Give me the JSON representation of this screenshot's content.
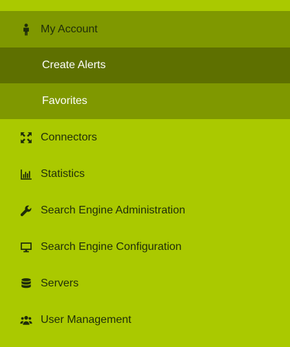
{
  "sidebar": {
    "account": {
      "label": "My Account",
      "icon": "person-icon",
      "children": [
        {
          "label": "Create Alerts",
          "active": true
        },
        {
          "label": "Favorites",
          "active": false
        }
      ]
    },
    "items": [
      {
        "label": "Connectors",
        "icon": "arrows-expand-icon"
      },
      {
        "label": "Statistics",
        "icon": "bar-chart-icon"
      },
      {
        "label": "Search Engine Administration",
        "icon": "wrench-icon"
      },
      {
        "label": "Search Engine Configuration",
        "icon": "monitor-icon"
      },
      {
        "label": "Servers",
        "icon": "database-icon"
      },
      {
        "label": "User Management",
        "icon": "users-icon"
      }
    ]
  },
  "colors": {
    "background": "#aac900",
    "submenu": "#7f9800",
    "submenu_active": "#5e7000",
    "text": "#1f2d0a"
  }
}
